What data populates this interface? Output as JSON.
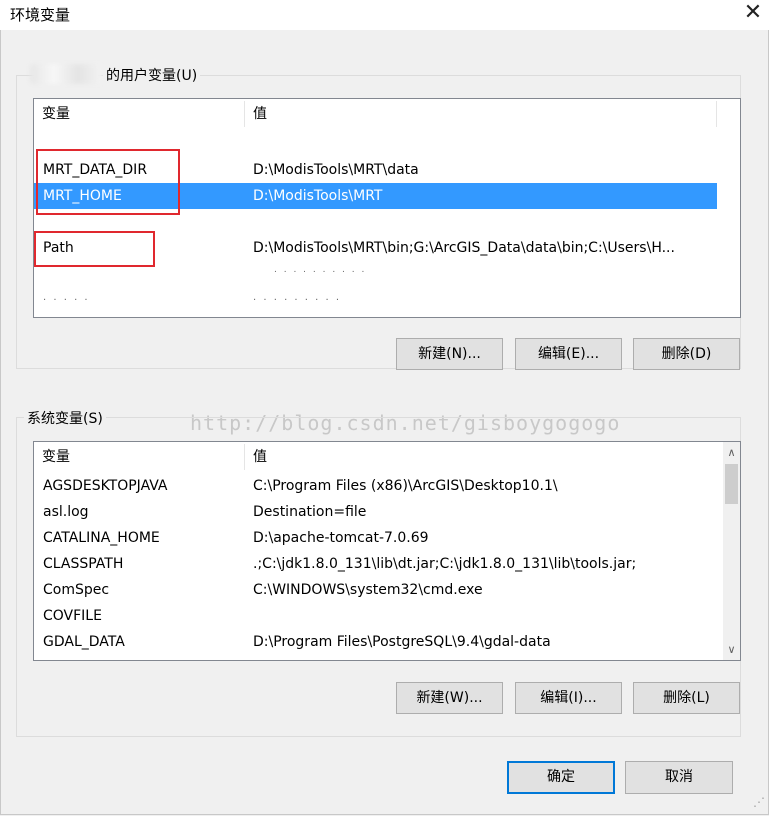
{
  "window": {
    "title": "环境变量",
    "close_glyph": "✕"
  },
  "user_vars": {
    "group_label": "的用户变量(U)",
    "col_name": "变量",
    "col_value": "值",
    "rows": [
      {
        "name": "MRT_DATA_DIR",
        "value": "D:\\ModisTools\\MRT\\data"
      },
      {
        "name": "MRT_HOME",
        "value": "D:\\ModisTools\\MRT",
        "selected": true
      },
      {
        "name": "Path",
        "value": "D:\\ModisTools\\MRT\\bin;G:\\ArcGIS_Data\\data\\bin;C:\\Users\\H..."
      }
    ],
    "faded_row": {
      "name": ". . . . .",
      "value": ". . . . . . . . ."
    },
    "faded_row2": {
      "value": ". . . . . . . . . ."
    },
    "buttons": {
      "new": "新建(N)...",
      "edit": "编辑(E)...",
      "delete": "删除(D)"
    }
  },
  "sys_vars": {
    "group_label": "系统变量(S)",
    "col_name": "变量",
    "col_value": "值",
    "rows": [
      {
        "name": "AGSDESKTOPJAVA",
        "value": "C:\\Program Files (x86)\\ArcGIS\\Desktop10.1\\"
      },
      {
        "name": "asl.log",
        "value": "Destination=file"
      },
      {
        "name": "CATALINA_HOME",
        "value": "D:\\apache-tomcat-7.0.69"
      },
      {
        "name": "CLASSPATH",
        "value": ".;C:\\jdk1.8.0_131\\lib\\dt.jar;C:\\jdk1.8.0_131\\lib\\tools.jar;"
      },
      {
        "name": "ComSpec",
        "value": "C:\\WINDOWS\\system32\\cmd.exe"
      },
      {
        "name": "COVFILE",
        "value": ""
      },
      {
        "name": "GDAL_DATA",
        "value": "D:\\Program Files\\PostgreSQL\\9.4\\gdal-data"
      }
    ],
    "scroll_up": "∧",
    "scroll_down": "∨",
    "buttons": {
      "new": "新建(W)...",
      "edit": "编辑(I)...",
      "delete": "删除(L)"
    }
  },
  "watermark": "http://blog.csdn.net/gisboygogogo",
  "footer": {
    "ok": "确定",
    "cancel": "取消"
  },
  "colors": {
    "selection": "#3399ff",
    "annotation_red": "#e0282e",
    "default_button_border": "#0078d7"
  }
}
